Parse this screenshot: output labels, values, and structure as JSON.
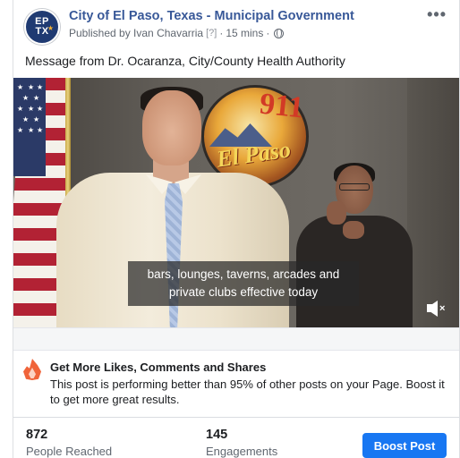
{
  "post": {
    "page_name": "City of El Paso, Texas - Municipal Government",
    "avatar_text_line1": "EP",
    "avatar_text_line2": "TX",
    "published_by": "Published by Ivan Chavarria",
    "help_marker": "[?]",
    "time": "15 mins",
    "separator": "·",
    "privacy_icon": "globe-icon",
    "more_icon": "more-options-icon",
    "more_text": "•••",
    "message": "Message from Dr. Ocaranza, City/County Health Authority"
  },
  "video": {
    "caption_line1": "bars, lounges, taverns, arcades and",
    "caption_line2": "private clubs effective today",
    "seal_number": "911",
    "seal_city": "El Paso",
    "mute_icon": "muted-speaker-icon",
    "mute_text": "×"
  },
  "boost": {
    "icon": "fire-icon",
    "title": "Get More Likes, Comments and Shares",
    "text": "This post is performing better than 95% of other posts on your Page. Boost it to get more great results."
  },
  "stats": {
    "reached_value": "872",
    "reached_label": "People Reached",
    "engagements_value": "145",
    "engagements_label": "Engagements",
    "boost_button": "Boost Post"
  },
  "colors": {
    "link": "#385898",
    "button": "#1877f2",
    "fire": "#f0643a"
  }
}
